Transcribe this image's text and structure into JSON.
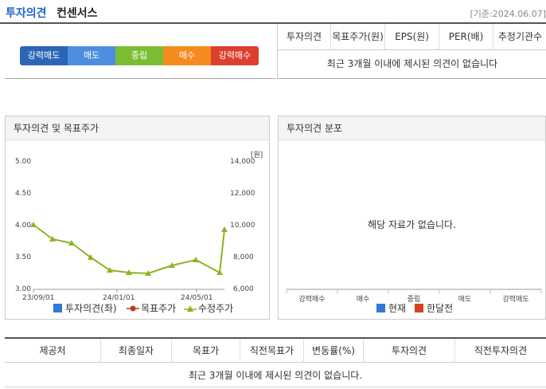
{
  "header": {
    "title_part1": "투자의견",
    "title_part2": "컨센서스",
    "date": "[기준:2024.06.07]"
  },
  "scale": {
    "items": [
      {
        "label": "강력매도",
        "color": "#2b65b6"
      },
      {
        "label": "매도",
        "color": "#4f8de0"
      },
      {
        "label": "중립",
        "color": "#7cbc33"
      },
      {
        "label": "매수",
        "color": "#f58b1f"
      },
      {
        "label": "강력매수",
        "color": "#dc3f2e"
      }
    ]
  },
  "consensus": {
    "headers": [
      "투자의견",
      "목표주가(원)",
      "EPS(원)",
      "PER(배)",
      "추정기관수"
    ],
    "empty_message": "최근 3개월 이내에 제시된 의견이 없습니다"
  },
  "chart1": {
    "title": "투자의견 및 목표주가",
    "unit_label": "[원]",
    "legend": [
      {
        "label": "투자의견(좌)",
        "color": "#2e7ad6",
        "icon": "square"
      },
      {
        "label": "목표주가",
        "color": "#c0391b",
        "icon": "line-circle"
      },
      {
        "label": "수정주가",
        "color": "#8ab523",
        "icon": "line-triangle"
      }
    ]
  },
  "chart2": {
    "title": "투자의견 분포",
    "empty_message": "해당 자료가 없습니다.",
    "categories": [
      "강력매수",
      "매수",
      "중립",
      "매도",
      "강력매도"
    ],
    "legend": [
      {
        "label": "현재",
        "color": "#2e7ad6"
      },
      {
        "label": "한달전",
        "color": "#d9401f"
      }
    ]
  },
  "bottom_table": {
    "headers": [
      "제공처",
      "최종일자",
      "목표가",
      "직전목표가",
      "변동률(%)",
      "투자의견",
      "직전투자의견"
    ],
    "empty_message": "최근 3개월 이내에 제시된 의견이 없습니다."
  },
  "chart_data": {
    "type": "line",
    "title": "투자의견 및 목표주가",
    "x_ticks": [
      "23/09/01",
      "24/01/01",
      "24/05/01"
    ],
    "y_left": {
      "ticks": [
        "5.00",
        "4.50",
        "4.00",
        "3.50",
        "3.00"
      ],
      "range": [
        3.0,
        5.0
      ]
    },
    "y_right": {
      "ticks": [
        "14,000",
        "12,000",
        "10,000",
        "8,000",
        "6,000"
      ],
      "range": [
        6000,
        14000
      ],
      "label": "[원]"
    },
    "x_range": [
      "2023-09-01",
      "2024-06-07"
    ],
    "series": [
      {
        "name": "수정주가",
        "axis": "right",
        "color": "#8ab523",
        "marker": "triangle",
        "points": [
          {
            "x": "2023-09-01",
            "y": 10050
          },
          {
            "x": "2023-09-29",
            "y": 9150
          },
          {
            "x": "2023-10-27",
            "y": 8900
          },
          {
            "x": "2023-11-24",
            "y": 8000
          },
          {
            "x": "2023-12-22",
            "y": 7200
          },
          {
            "x": "2024-01-19",
            "y": 7050
          },
          {
            "x": "2024-02-16",
            "y": 7000
          },
          {
            "x": "2024-03-22",
            "y": 7500
          },
          {
            "x": "2024-04-26",
            "y": 7850
          },
          {
            "x": "2024-05-31",
            "y": 7050
          },
          {
            "x": "2024-06-07",
            "y": 9750
          }
        ]
      }
    ]
  }
}
